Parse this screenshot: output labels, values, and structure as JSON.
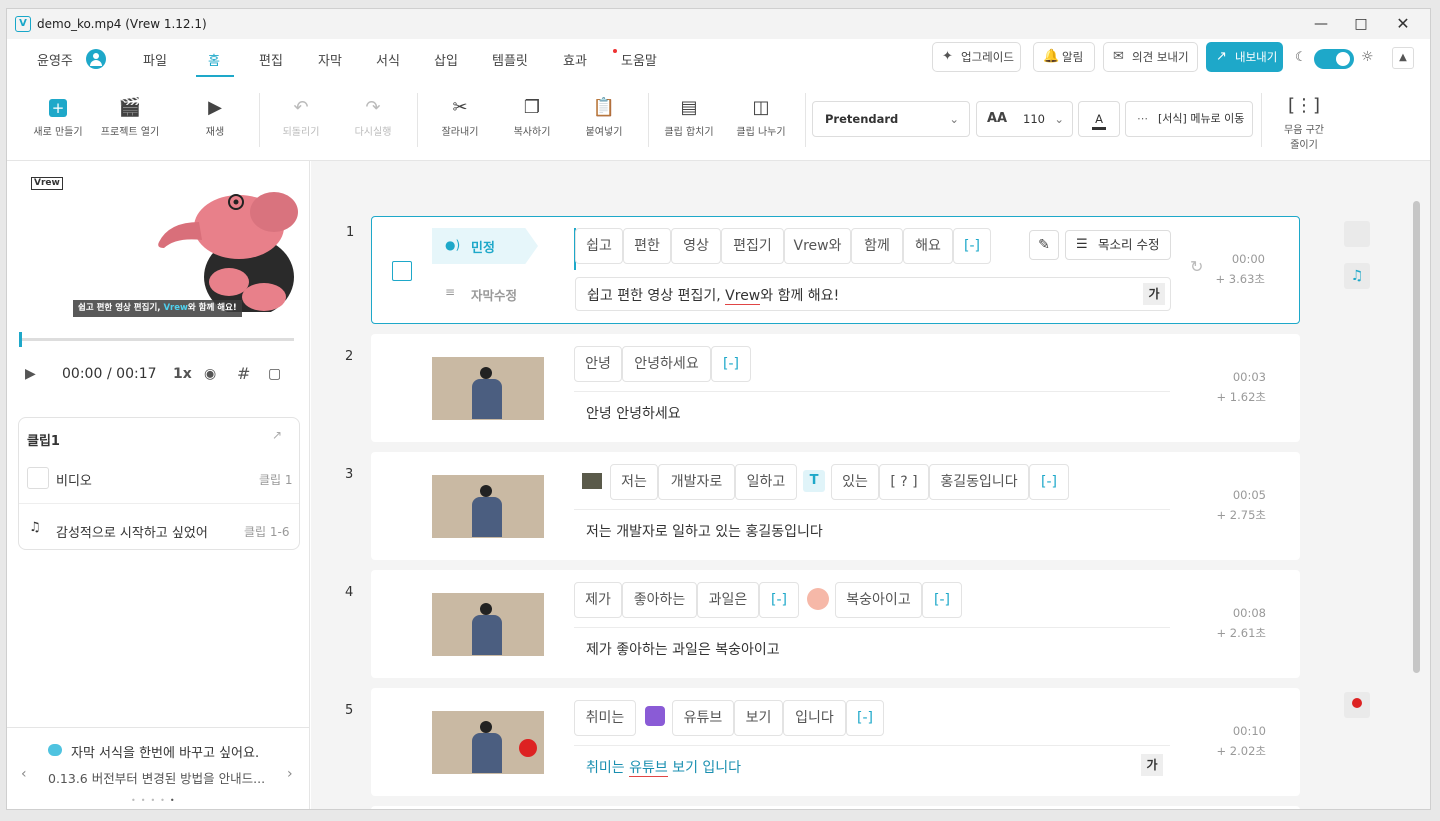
{
  "window": {
    "title": "demo_ko.mp4 (Vrew 1.12.1)",
    "minimize_icon": "minimize-icon",
    "maximize_icon": "maximize-icon",
    "close_icon": "close-icon"
  },
  "menu": {
    "user": "윤영주",
    "tabs": [
      "파일",
      "홈",
      "편집",
      "자막",
      "서식",
      "삽입",
      "템플릿",
      "효과",
      "도움말"
    ],
    "active_tab": "홈",
    "upgrade": "업그레이드",
    "alarm": "알림",
    "feedback": "의견 보내기",
    "export": "내보내기",
    "accent": "#1ea8c9"
  },
  "toolbar": {
    "new": "새로 만들기",
    "open": "프로젝트 열기",
    "play": "재생",
    "undo": "되돌리기",
    "redo": "다시실행",
    "cut": "잘라내기",
    "copy": "복사하기",
    "paste": "붙여넣기",
    "merge": "클립 합치기",
    "split": "클립 나누기",
    "font": "Pretendard",
    "font_size": "110",
    "font_color_letter": "A",
    "format_move": "[서식] 메뉴로 이동",
    "silence_l1": "무음 구간",
    "silence_l2": "줄이기"
  },
  "preview": {
    "logo": "Vrew",
    "caption_pre": "쉽고 편한 영상 편집기, ",
    "caption_brand": "Vrew",
    "caption_post": "와 함께 해요!",
    "time_current": "00:00",
    "time_total": "/ 00:17",
    "speed": "1x"
  },
  "clip_panel": {
    "title": "클립1",
    "video_label": "비디오",
    "video_clip": "클립 1",
    "music_label": "감성적으로 시작하고 싶었어",
    "music_clip": "클립 1-6"
  },
  "tip": {
    "title": "자막 서식을 한번에 바꾸고 싶어요.",
    "body": "0.13.6 버전부터 변경된 방법을 안내드..."
  },
  "clips": [
    {
      "num": "1",
      "speaker": "민정",
      "subtitle_edit": "자막수정",
      "words": [
        "쉽고",
        "편한",
        "영상",
        "편집기",
        "Vrew와",
        "함께",
        "해요",
        "[-]"
      ],
      "text": "쉽고 편한 영상 편집기, Vrew와 함께 해요!",
      "voice_edit": "목소리 수정",
      "time": "00:00",
      "duration": "+ 3.63초",
      "ga": "가"
    },
    {
      "num": "2",
      "words": [
        "안녕",
        "안녕하세요",
        "[-]"
      ],
      "text": "안녕 안녕하세요",
      "time": "00:03",
      "duration": "+ 1.62초"
    },
    {
      "num": "3",
      "words": [
        "저는",
        "개발자로",
        "일하고",
        "있는",
        "[ ? ]",
        "홍길동입니다",
        "[-]"
      ],
      "text": "저는 개발자로 일하고 있는 홍길동입니다",
      "time": "00:05",
      "duration": "+ 2.75초"
    },
    {
      "num": "4",
      "words": [
        "제가",
        "좋아하는",
        "과일은",
        "[-]",
        "복숭아이고",
        "[-]"
      ],
      "text": "제가 좋아하는 과일은 복숭아이고",
      "time": "00:08",
      "duration": "+ 2.61초"
    },
    {
      "num": "5",
      "words": [
        "취미는",
        "유튜브",
        "보기",
        "입니다",
        "[-]"
      ],
      "text": "취미는 유튜브 보기 입니다",
      "time": "00:10",
      "duration": "+ 2.02초",
      "ga": "가"
    }
  ]
}
